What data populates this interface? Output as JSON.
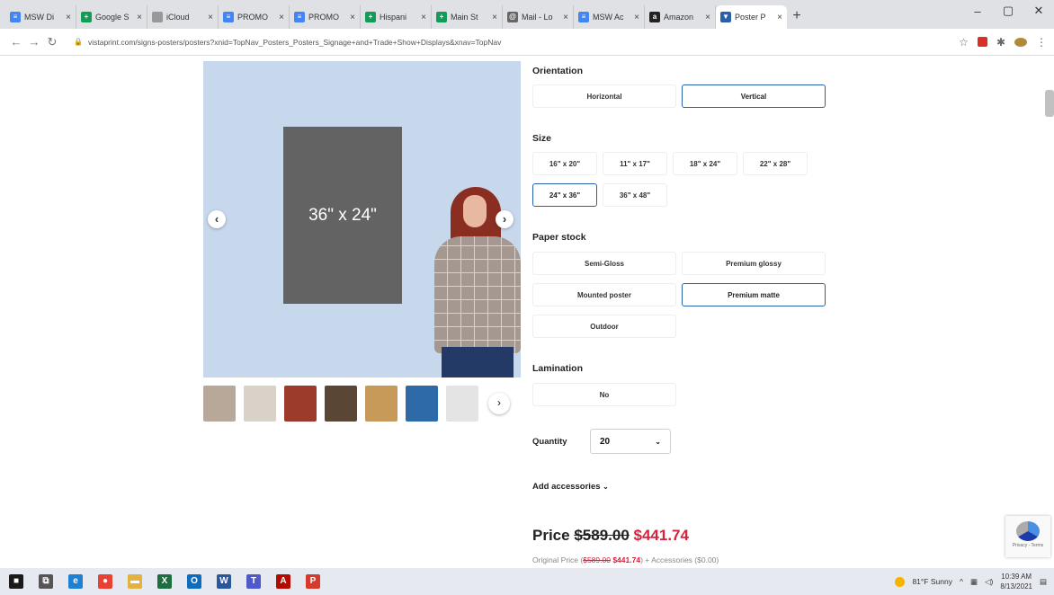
{
  "browser": {
    "tabs": [
      {
        "label": "MSW Di",
        "icon": "docs-icon",
        "color": "#4285f4",
        "glyph": "≡"
      },
      {
        "label": "Google S",
        "icon": "sheets-icon",
        "color": "#0f9d58",
        "glyph": "+"
      },
      {
        "label": "iCloud",
        "icon": "apple-icon",
        "color": "#999999",
        "glyph": ""
      },
      {
        "label": "PROMO",
        "icon": "docs-icon",
        "color": "#4285f4",
        "glyph": "≡"
      },
      {
        "label": "PROMO",
        "icon": "docs-icon",
        "color": "#4285f4",
        "glyph": "≡"
      },
      {
        "label": "Hispani",
        "icon": "sheets-icon",
        "color": "#0f9d58",
        "glyph": "+"
      },
      {
        "label": "Main St",
        "icon": "sheets-icon",
        "color": "#0f9d58",
        "glyph": "+"
      },
      {
        "label": "Mail - Lo",
        "icon": "mail-icon",
        "color": "#666666",
        "glyph": "@"
      },
      {
        "label": "MSW Ac",
        "icon": "docs-icon",
        "color": "#4285f4",
        "glyph": "≡"
      },
      {
        "label": "Amazon",
        "icon": "amazon-icon",
        "color": "#222222",
        "glyph": "a"
      },
      {
        "label": "Poster P",
        "icon": "vistaprint-icon",
        "color": "#2a5fab",
        "glyph": "▼"
      }
    ],
    "new_tab": "+",
    "window_controls": [
      "–",
      "▢",
      "✕"
    ],
    "url": "vistaprint.com/signs-posters/posters?xnid=TopNav_Posters_Posters_Signage+and+Trade+Show+Displays&xnav=TopNav"
  },
  "gallery": {
    "poster_label": "36\" x 24\"",
    "prev": "‹",
    "next": "›",
    "thumb_next": "›",
    "thumbnails": [
      {
        "color": "#b8a89a"
      },
      {
        "color": "#d8d2c8"
      },
      {
        "color": "#9c3a2c"
      },
      {
        "color": "#5a4634"
      },
      {
        "color": "#c79a5a"
      },
      {
        "color": "#2e6aa8"
      },
      {
        "color": "#e4e4e4"
      }
    ]
  },
  "options": {
    "orientation": {
      "title": "Orientation",
      "items": [
        {
          "label": "Horizontal",
          "selected": false
        },
        {
          "label": "Vertical",
          "selected": true
        }
      ]
    },
    "size": {
      "title": "Size",
      "items": [
        {
          "label": "16\" x 20\"",
          "selected": false
        },
        {
          "label": "11\" x 17\"",
          "selected": false
        },
        {
          "label": "18\" x 24\"",
          "selected": false
        },
        {
          "label": "22\" x 28\"",
          "selected": false
        },
        {
          "label": "24\" x 36\"",
          "selected": true
        },
        {
          "label": "36\" x 48\"",
          "selected": false
        }
      ]
    },
    "paper": {
      "title": "Paper stock",
      "items": [
        {
          "label": "Semi-Gloss",
          "selected": false
        },
        {
          "label": "Premium glossy",
          "selected": false
        },
        {
          "label": "Mounted poster",
          "selected": false
        },
        {
          "label": "Premium matte",
          "selected": true
        },
        {
          "label": "Outdoor",
          "selected": false
        }
      ]
    },
    "lamination": {
      "title": "Lamination",
      "items": [
        {
          "label": "No",
          "selected": false
        }
      ]
    },
    "quantity": {
      "label": "Quantity",
      "value": "20",
      "chevron": "⌄"
    },
    "accessories": {
      "label": "Add accessories",
      "chevron": "⌄"
    },
    "price": {
      "label": "Price",
      "old": "$589.00",
      "new": "$441.74",
      "orig_prefix": "Original Price (",
      "orig_old": "$589.00",
      "orig_new": "$441.74",
      "orig_suffix": ") + Accessories ($0.00)"
    }
  },
  "recaptcha": {
    "text": "Privacy - Terms"
  },
  "taskbar": {
    "apps": [
      {
        "icon": "start-icon",
        "color": "#1a1a1a",
        "glyph": "■"
      },
      {
        "icon": "task-view-icon",
        "color": "#555555",
        "glyph": "⧉"
      },
      {
        "icon": "edge-icon",
        "color": "#1f7fd1",
        "glyph": "e"
      },
      {
        "icon": "chrome-icon",
        "color": "#e94235",
        "glyph": "●"
      },
      {
        "icon": "file-explorer-icon",
        "color": "#e3b341",
        "glyph": "▬"
      },
      {
        "icon": "excel-icon",
        "color": "#1d6f42",
        "glyph": "X"
      },
      {
        "icon": "outlook-icon",
        "color": "#0f6cbd",
        "glyph": "O"
      },
      {
        "icon": "word-icon",
        "color": "#2b579a",
        "glyph": "W"
      },
      {
        "icon": "teams-icon",
        "color": "#5059c9",
        "glyph": "T"
      },
      {
        "icon": "acrobat-icon",
        "color": "#b30b00",
        "glyph": "A"
      },
      {
        "icon": "pdf-icon",
        "color": "#d63a2d",
        "glyph": "P"
      }
    ],
    "weather": "81°F Sunny",
    "time": "10:39 AM",
    "date": "8/13/2021"
  }
}
